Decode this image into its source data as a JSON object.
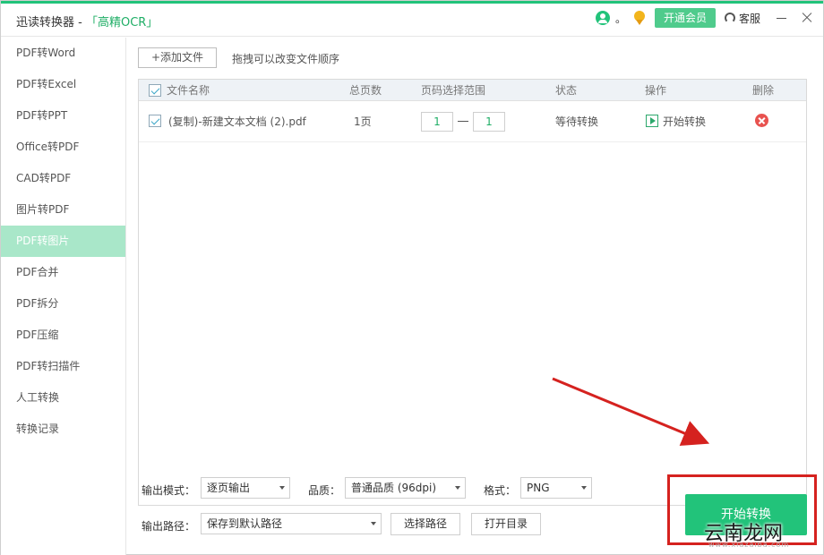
{
  "window": {
    "title_prefix": "迅读转换器 - ",
    "title_ocr": "「高精OCR」",
    "user_text": "。",
    "vip_label": "开通会员",
    "service_label": "客服"
  },
  "sidebar": {
    "items": [
      {
        "label": "PDF转Word"
      },
      {
        "label": "PDF转Excel"
      },
      {
        "label": "PDF转PPT"
      },
      {
        "label": "Office转PDF"
      },
      {
        "label": "CAD转PDF"
      },
      {
        "label": "图片转PDF"
      },
      {
        "label": "PDF转图片"
      },
      {
        "label": "PDF合并"
      },
      {
        "label": "PDF拆分"
      },
      {
        "label": "PDF压缩"
      },
      {
        "label": "PDF转扫描件"
      },
      {
        "label": "人工转换"
      },
      {
        "label": "转换记录"
      }
    ],
    "active_index": 6
  },
  "toolbar": {
    "add_file_label": "+添加文件",
    "drag_hint": "拖拽可以改变文件顺序"
  },
  "table": {
    "headers": {
      "name": "文件名称",
      "pages": "总页数",
      "range": "页码选择范围",
      "status": "状态",
      "action": "操作",
      "delete": "删除"
    },
    "rows": [
      {
        "name": "(复制)-新建文本文档 (2).pdf",
        "pages": "1页",
        "range_from": "1",
        "range_to": "1",
        "status": "等待转换",
        "action": "开始转换"
      }
    ]
  },
  "options": {
    "output_mode_label": "输出模式：",
    "output_mode_value": "逐页输出",
    "quality_label": "品质：",
    "quality_value": "普通品质 (96dpi)",
    "format_label": "格式：",
    "format_value": "PNG",
    "output_path_label": "输出路径：",
    "output_path_value": "保存到默认路径",
    "choose_path_label": "选择路径",
    "open_dir_label": "打开目录"
  },
  "start_button_label": "开始转换",
  "watermark": {
    "text": "云南龙网",
    "sub": "www.xiazaiba.com"
  },
  "colors": {
    "accent": "#22c37a",
    "sidebar_active": "#a9e7c9",
    "annotation_red": "#d5221f"
  }
}
